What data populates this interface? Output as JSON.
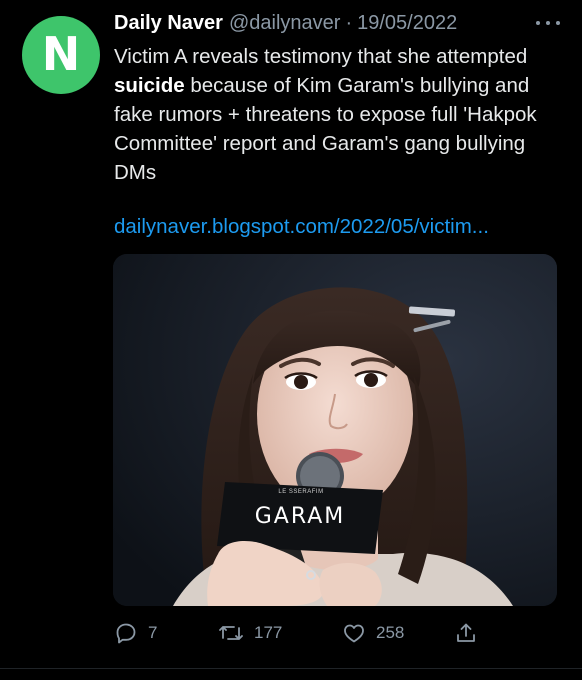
{
  "tweet": {
    "avatar_letter": "N",
    "author_name": "Daily Naver",
    "handle": "@dailynaver",
    "separator": "·",
    "date": "19/05/2022",
    "text_part1": "Victim A reveals testimony that she attempted ",
    "text_bold": "suicide",
    "text_part2": " because of Kim Garam's bullying and fake rumors + threatens to expose full 'Hakpok Committee' report and Garam's gang bullying DMs",
    "link": "dailynaver.blogspot.com/2022/05/victim...",
    "media": {
      "mic_flag_text": "GARAM",
      "mic_brand_text": "LE SSERAFIM"
    },
    "actions": {
      "replies": "7",
      "retweets": "177",
      "likes": "258"
    }
  },
  "colors": {
    "background": "#000000",
    "avatar_green": "#3ec56b",
    "link_blue": "#1d9bf0",
    "muted_gray": "#8b98a5"
  },
  "icons": [
    "more-icon",
    "reply-icon",
    "retweet-icon",
    "like-icon",
    "share-icon"
  ]
}
